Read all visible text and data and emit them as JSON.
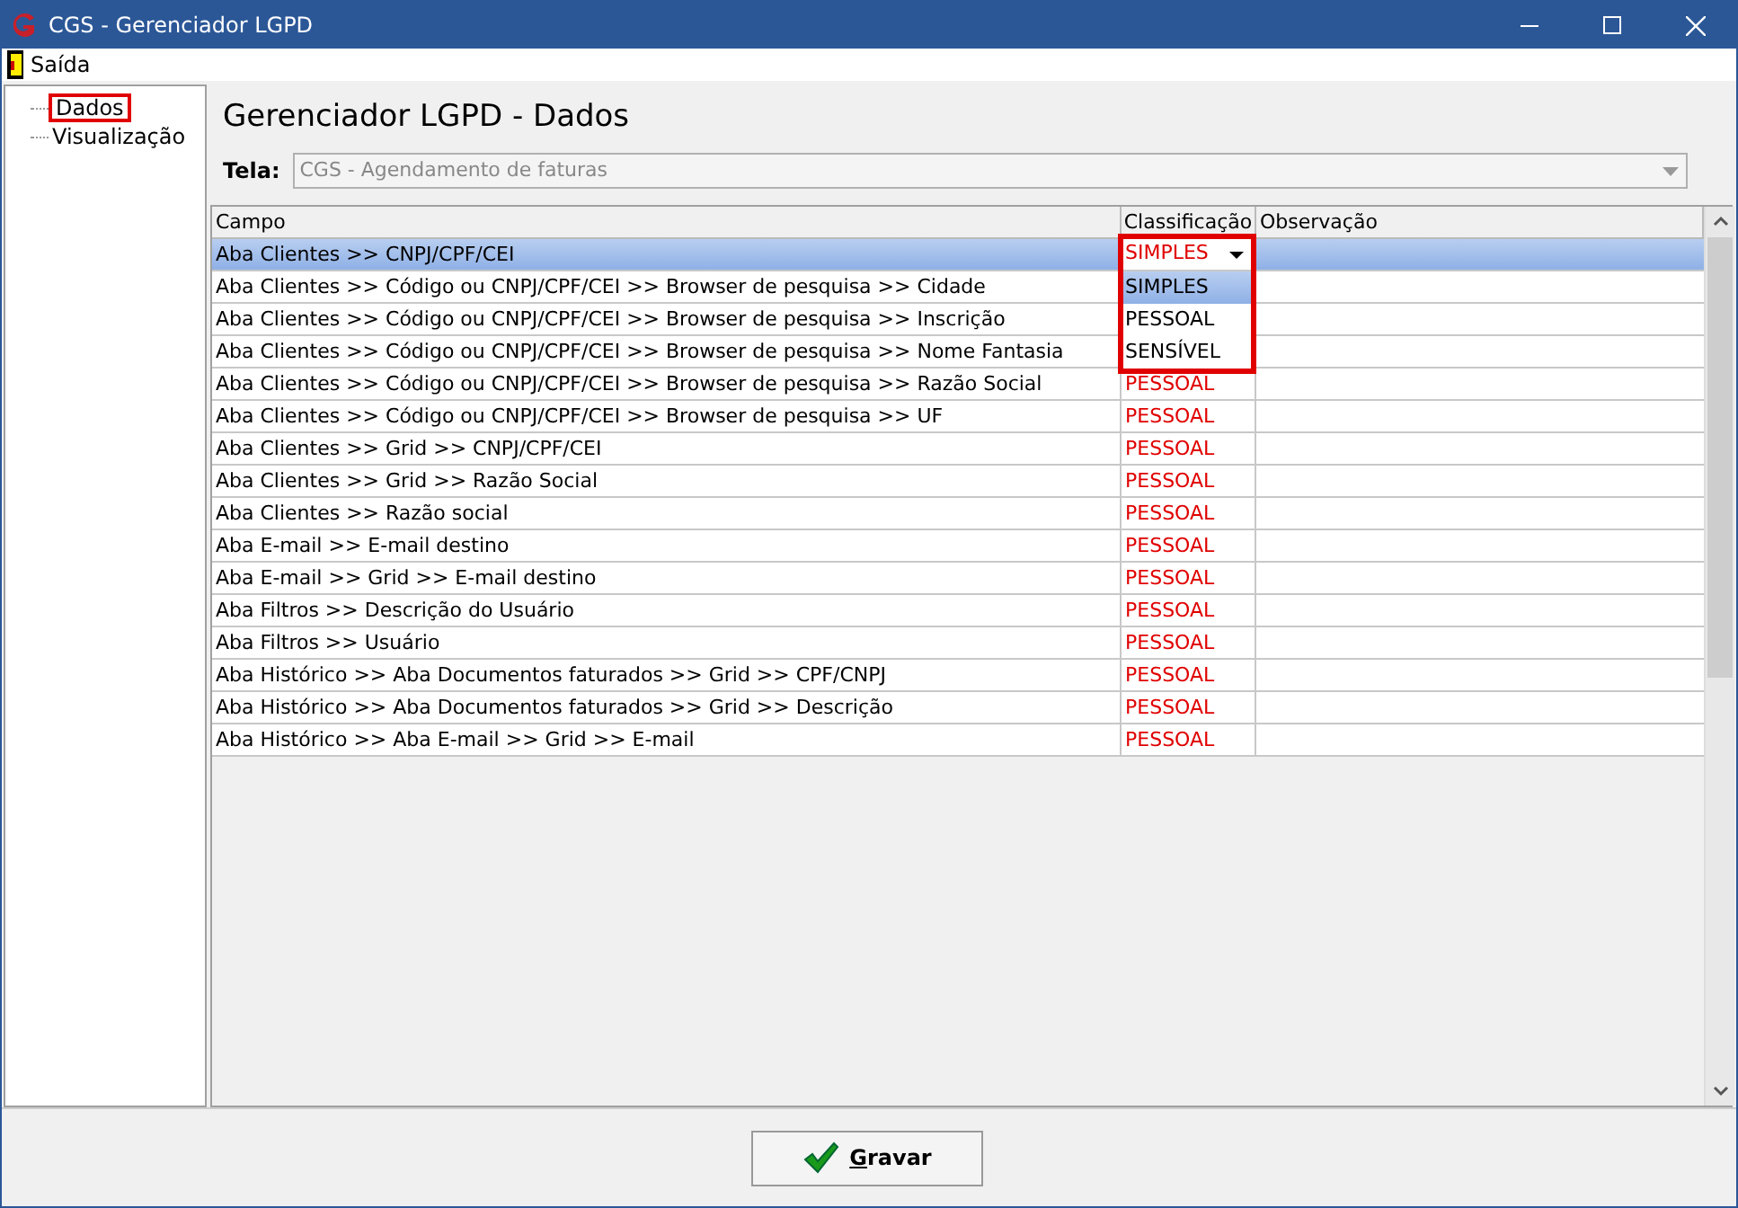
{
  "window": {
    "title": "CGS - Gerenciador LGPD"
  },
  "menu": [
    "Saída"
  ],
  "sidebar": {
    "items": [
      {
        "label": "Dados",
        "selected": true
      },
      {
        "label": "Visualização",
        "selected": false
      }
    ]
  },
  "heading": "Gerenciador LGPD - Dados",
  "tela": {
    "label": "Tela:",
    "value": "CGS - Agendamento de faturas"
  },
  "table": {
    "columns": [
      "Campo",
      "Classificação",
      "Observação"
    ],
    "rows": [
      {
        "campo": "Aba Clientes >> CNPJ/CPF/CEI",
        "classificacao": "SIMPLES",
        "selected": true,
        "editing": true
      },
      {
        "campo": "Aba Clientes >> Código ou CNPJ/CPF/CEI >> Browser de pesquisa >> Cidade",
        "selected": false
      },
      {
        "campo": "Aba Clientes >> Código ou CNPJ/CPF/CEI >> Browser de pesquisa >> Inscrição",
        "selected": false
      },
      {
        "campo": "Aba Clientes >> Código ou CNPJ/CPF/CEI >> Browser de pesquisa >> Nome Fantasia",
        "selected": false
      },
      {
        "campo": "Aba Clientes >> Código ou CNPJ/CPF/CEI >> Browser de pesquisa >> Razão Social",
        "classificacao": "PESSOAL",
        "selected": false
      },
      {
        "campo": "Aba Clientes >> Código ou CNPJ/CPF/CEI >> Browser de pesquisa >> UF",
        "classificacao": "PESSOAL",
        "selected": false
      },
      {
        "campo": "Aba Clientes >> Grid >> CNPJ/CPF/CEI",
        "classificacao": "PESSOAL",
        "selected": false
      },
      {
        "campo": "Aba Clientes >> Grid >> Razão Social",
        "classificacao": "PESSOAL",
        "selected": false
      },
      {
        "campo": "Aba Clientes >> Razão social",
        "classificacao": "PESSOAL",
        "selected": false
      },
      {
        "campo": "Aba E-mail >> E-mail destino",
        "classificacao": "PESSOAL",
        "selected": false
      },
      {
        "campo": "Aba E-mail >> Grid >> E-mail destino",
        "classificacao": "PESSOAL",
        "selected": false
      },
      {
        "campo": "Aba Filtros >> Descrição do Usuário",
        "classificacao": "PESSOAL",
        "selected": false
      },
      {
        "campo": "Aba Filtros >> Usuário",
        "classificacao": "PESSOAL",
        "selected": false
      },
      {
        "campo": "Aba Histórico >> Aba Documentos faturados >> Grid >> CPF/CNPJ",
        "classificacao": "PESSOAL",
        "selected": false
      },
      {
        "campo": "Aba Histórico >> Aba Documentos faturados >> Grid >> Descrição",
        "classificacao": "PESSOAL",
        "selected": false
      },
      {
        "campo": "Aba Histórico >> Aba E-mail >> Grid >> E-mail",
        "classificacao": "PESSOAL",
        "selected": false
      }
    ],
    "dropdown": {
      "options": [
        {
          "label": "SIMPLES",
          "selected": true
        },
        {
          "label": "PESSOAL",
          "selected": false
        },
        {
          "label": "SENSÍVEL",
          "selected": false
        }
      ]
    }
  },
  "save_button": "Gravar"
}
